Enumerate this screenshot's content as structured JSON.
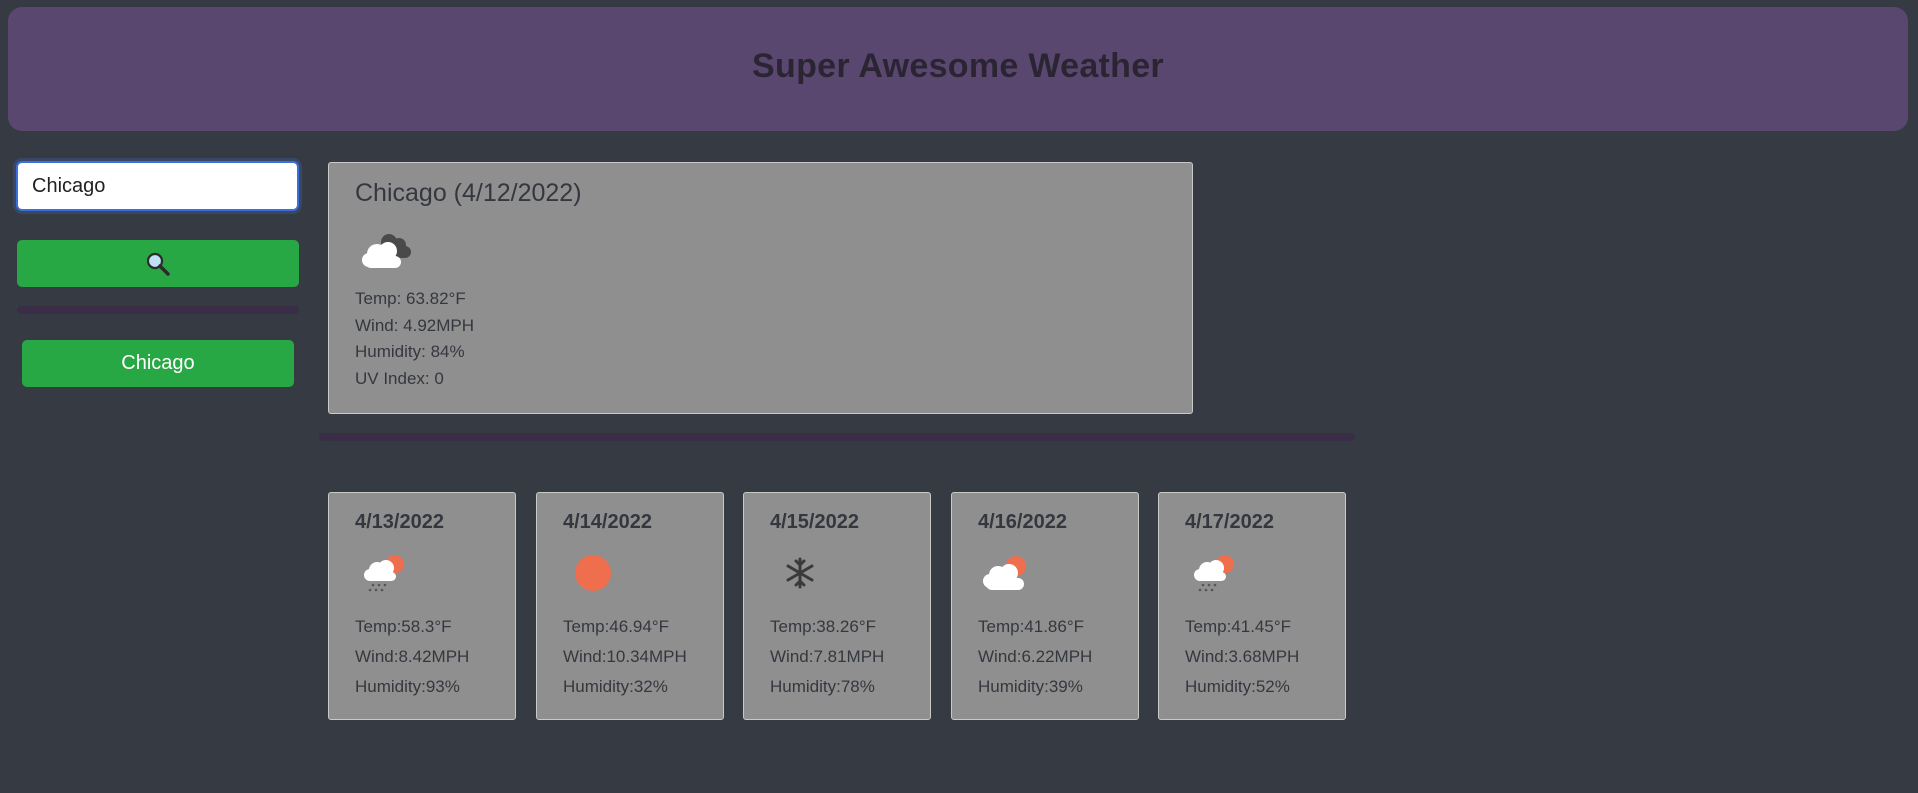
{
  "header": {
    "title": "Super Awesome Weather"
  },
  "search": {
    "value": "Chicago",
    "button_icon": "search-icon"
  },
  "history": [
    {
      "label": "Chicago"
    }
  ],
  "current": {
    "title": "Chicago (4/12/2022)",
    "icon": "cloudy-icon",
    "temp": "Temp: 63.82°F",
    "wind": "Wind: 4.92MPH",
    "humidity": "Humidity: 84%",
    "uv": "UV Index: 0"
  },
  "forecast": [
    {
      "date": "4/13/2022",
      "icon": "rain-sun-icon",
      "temp": "Temp:58.3°F",
      "wind": "Wind:8.42MPH",
      "humidity": "Humidity:93%"
    },
    {
      "date": "4/14/2022",
      "icon": "sun-icon",
      "temp": "Temp:46.94°F",
      "wind": "Wind:10.34MPH",
      "humidity": "Humidity:32%"
    },
    {
      "date": "4/15/2022",
      "icon": "snowflake-icon",
      "temp": "Temp:38.26°F",
      "wind": "Wind:7.81MPH",
      "humidity": "Humidity:78%"
    },
    {
      "date": "4/16/2022",
      "icon": "partly-cloudy-icon",
      "temp": "Temp:41.86°F",
      "wind": "Wind:6.22MPH",
      "humidity": "Humidity:39%"
    },
    {
      "date": "4/17/2022",
      "icon": "rain-sun-icon",
      "temp": "Temp:41.45°F",
      "wind": "Wind:3.68MPH",
      "humidity": "Humidity:52%"
    }
  ],
  "colors": {
    "header": "#5a4770",
    "background": "#353a43",
    "button": "#28a745",
    "card": "#8f8f8f",
    "sun": "#ee6e4d"
  }
}
